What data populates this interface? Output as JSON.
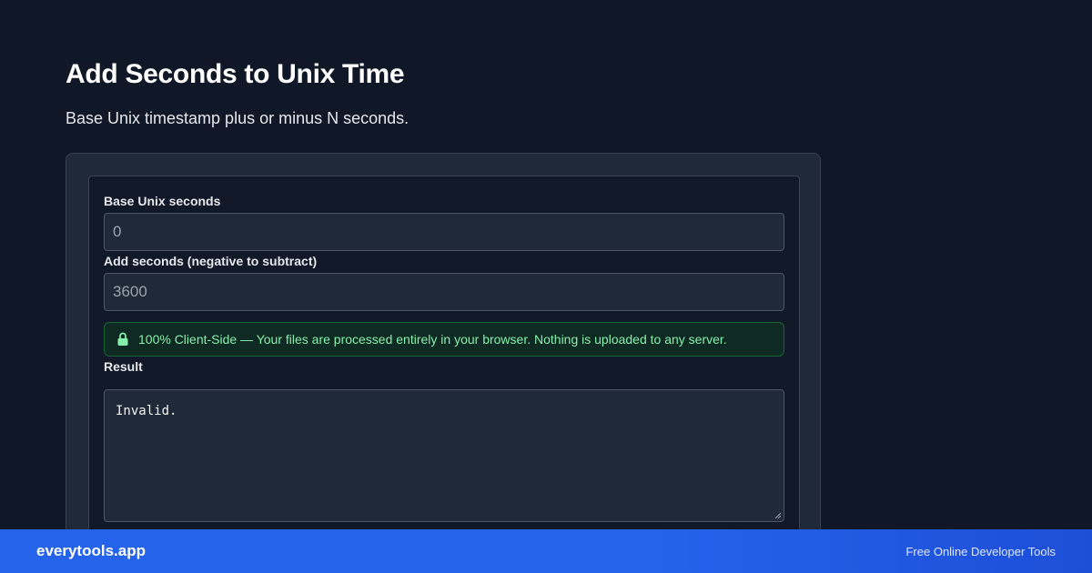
{
  "page": {
    "title": "Add Seconds to Unix Time",
    "subtitle": "Base Unix timestamp plus or minus N seconds."
  },
  "form": {
    "base_label": "Base Unix seconds",
    "base_placeholder": "0",
    "add_label": "Add seconds (negative to subtract)",
    "add_placeholder": "3600",
    "notice_icon": "lock-icon",
    "notice_text": "100% Client-Side — Your files are processed entirely in your browser. Nothing is uploaded to any server.",
    "result_label": "Result",
    "result_value": "Invalid."
  },
  "footer": {
    "brand": "everytools.app",
    "tagline": "Free Online Developer Tools"
  },
  "colors": {
    "background": "#101827",
    "card": "#1f2937",
    "notice_text": "#86efac",
    "footer_accent": "#2563eb"
  }
}
